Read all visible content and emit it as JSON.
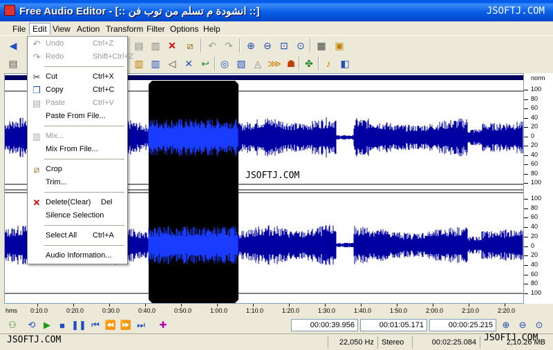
{
  "window": {
    "title": "Free Audio Editor - [:: انشودة م تسلم من توب فن ::]",
    "watermark": "JSOFTJ.COM"
  },
  "menubar": {
    "items": [
      "File",
      "Edit",
      "View",
      "Action",
      "Transform",
      "Filter",
      "Options",
      "Help"
    ],
    "active": "Edit"
  },
  "edit_menu": {
    "undo": {
      "label": "Undo",
      "shortcut": "Ctrl+Z"
    },
    "redo": {
      "label": "Redo",
      "shortcut": "Shift+Ctrl+Z"
    },
    "cut": {
      "label": "Cut",
      "shortcut": "Ctrl+X"
    },
    "copy": {
      "label": "Copy",
      "shortcut": "Ctrl+C"
    },
    "paste": {
      "label": "Paste",
      "shortcut": "Ctrl+V"
    },
    "paste_from_file": {
      "label": "Paste From File..."
    },
    "mix": {
      "label": "Mix..."
    },
    "mix_from_file": {
      "label": "Mix From File..."
    },
    "crop": {
      "label": "Crop"
    },
    "trim": {
      "label": "Trim..."
    },
    "delete": {
      "label": "Delete(Clear)",
      "shortcut": "Del"
    },
    "silence_selection": {
      "label": "Silence Selection"
    },
    "select_all": {
      "label": "Select All",
      "shortcut": "Ctrl+A"
    },
    "audio_information": {
      "label": "Audio Information..."
    }
  },
  "ruler": {
    "norm_label": "norm",
    "channel1_labels": [
      "100",
      "80",
      "60",
      "40",
      "20",
      "0",
      "20",
      "40",
      "60",
      "80",
      "100"
    ],
    "channel2_labels": [
      "100",
      "80",
      "60",
      "40",
      "20",
      "0",
      "20",
      "40",
      "60",
      "80",
      "100"
    ]
  },
  "timeline": {
    "unit": "hms",
    "labels": [
      "0:10.0",
      "0:20.0",
      "0:30.0",
      "0:40.0",
      "0:50.0",
      "1:00.0",
      "1:10.0",
      "1:20.0",
      "1:30.0",
      "1:40.0",
      "1:50.0",
      "2:00.0",
      "2:10.0",
      "2:20.0"
    ]
  },
  "transport": {
    "selection_start": "00:00:39.956",
    "selection_end": "00:01:05.171",
    "selection_length": "00:00:25.215"
  },
  "status": {
    "sample_rate": "22,050 Hz",
    "channels": "Stereo",
    "duration": "00:02:25.084",
    "file_size": "2,10.26 MB"
  },
  "colors": {
    "waveform": "#0000a0",
    "selection_bg": "#000000",
    "selection_wave": "#1a3cff",
    "titlebar": "#0a5fe8"
  },
  "wave_overlay_text": "JSOFTJ.COM"
}
